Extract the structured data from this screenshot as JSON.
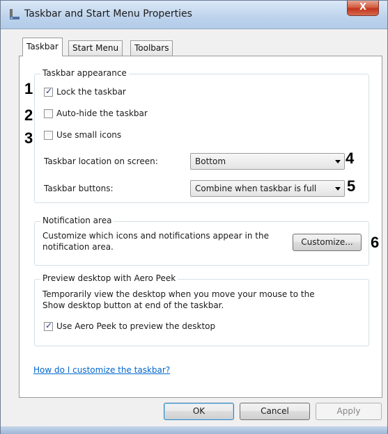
{
  "window": {
    "title": "Taskbar and Start Menu Properties",
    "icon": "taskbar-properties-icon",
    "close_label": "X"
  },
  "tabs": [
    {
      "label": "Taskbar",
      "active": true
    },
    {
      "label": "Start Menu",
      "active": false
    },
    {
      "label": "Toolbars",
      "active": false
    }
  ],
  "appearance": {
    "group_title": "Taskbar appearance",
    "lock": {
      "label": "Lock the taskbar",
      "checked": true
    },
    "autohide": {
      "label": "Auto-hide the taskbar",
      "checked": false
    },
    "small_icons": {
      "label": "Use small icons",
      "checked": false
    },
    "location_label": "Taskbar location on screen:",
    "location_value": "Bottom",
    "buttons_label": "Taskbar buttons:",
    "buttons_value": "Combine when taskbar is full"
  },
  "notification": {
    "group_title": "Notification area",
    "desc_line1": "Customize which icons and notifications appear in the",
    "desc_line2": "notification area.",
    "customize_label": "Customize..."
  },
  "aero_peek": {
    "group_title": "Preview desktop with Aero Peek",
    "desc_line1": "Temporarily view the desktop when you move your mouse to the",
    "desc_line2": "Show desktop button at end of the taskbar.",
    "checkbox": {
      "label": "Use Aero Peek to preview the desktop",
      "checked": true
    }
  },
  "help_link": "How do I customize the taskbar?",
  "buttons": {
    "ok": "OK",
    "cancel": "Cancel",
    "apply": "Apply"
  },
  "callouts": [
    "1",
    "2",
    "3",
    "4",
    "5",
    "6"
  ],
  "colors": {
    "link": "#0066cc",
    "close_button": "#c2351c",
    "titlebar": "#bdd3ec"
  }
}
